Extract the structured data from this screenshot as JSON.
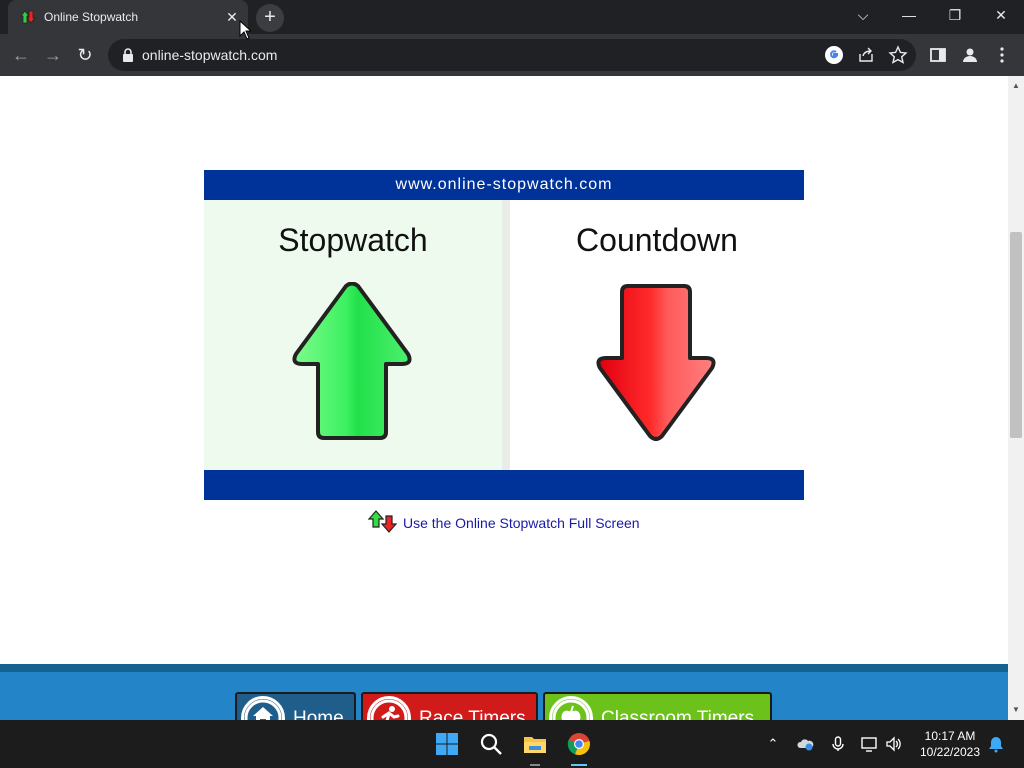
{
  "browser": {
    "tab_title": "Online Stopwatch",
    "tab_close": "✕",
    "new_tab": "+",
    "url": "online-stopwatch.com",
    "window_controls": {
      "chevron": "⌵",
      "minimize": "—",
      "restore": "❐",
      "close": "✕"
    },
    "nav": {
      "back": "←",
      "forward": "→",
      "reload": "↻"
    }
  },
  "page": {
    "header_url": "www.online-stopwatch.com",
    "stopwatch_label": "Stopwatch",
    "countdown_label": "Countdown",
    "fullscreen_link": "Use the Online Stopwatch Full Screen",
    "nav_tiles": [
      {
        "label": "Home",
        "color": "#1f5d8a"
      },
      {
        "label": "Race Timers",
        "color": "#d11a1a"
      },
      {
        "label": "Classroom Timers",
        "color": "#6cc21a"
      }
    ]
  },
  "taskbar": {
    "time": "10:17 AM",
    "date": "10/22/2023"
  },
  "colors": {
    "brand_blue": "#003399",
    "green_arrow": "#33ee55",
    "red_arrow": "#ee2222"
  }
}
